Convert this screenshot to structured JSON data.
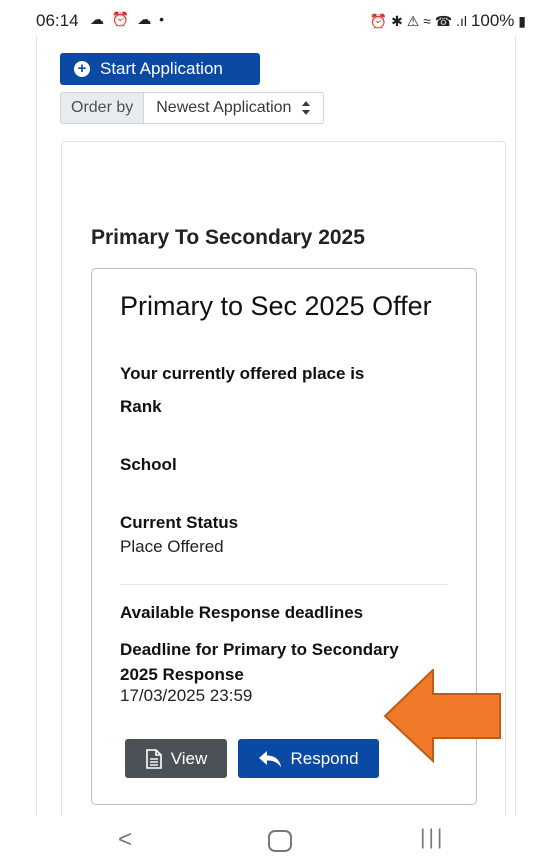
{
  "status_bar": {
    "time": "06:14",
    "left_icons": "☁ ⏰ ☁ •",
    "right_icons": "⏰ ✱ ⚠ ≈ ☎ .ıl",
    "battery": "100%"
  },
  "toolbar": {
    "start_label": "Start Application",
    "order_label": "Order by",
    "order_value": "Newest Application"
  },
  "application": {
    "section_title": "Primary To Secondary 2025",
    "offer_title": "Primary to Sec 2025 Offer",
    "offered_place_label": "Your currently offered place is",
    "rank_label": "Rank",
    "school_label": "School",
    "status_label": "Current Status",
    "status_value": "Place Offered",
    "deadlines_heading": "Available Response deadlines",
    "deadline_label": "Deadline for Primary to Secondary 2025 Response",
    "deadline_value": "17/03/2025 23:59",
    "view_label": "View",
    "respond_label": "Respond"
  },
  "colors": {
    "primary": "#0a4aa5",
    "secondary": "#4b5257",
    "arrow": "#f07a2a"
  },
  "icons": [
    "plus-circle-icon",
    "sort-icon",
    "document-icon",
    "reply-arrow-icon",
    "orange-pointer-arrow",
    "nav-back-icon",
    "nav-home-icon",
    "nav-recent-icon"
  ]
}
